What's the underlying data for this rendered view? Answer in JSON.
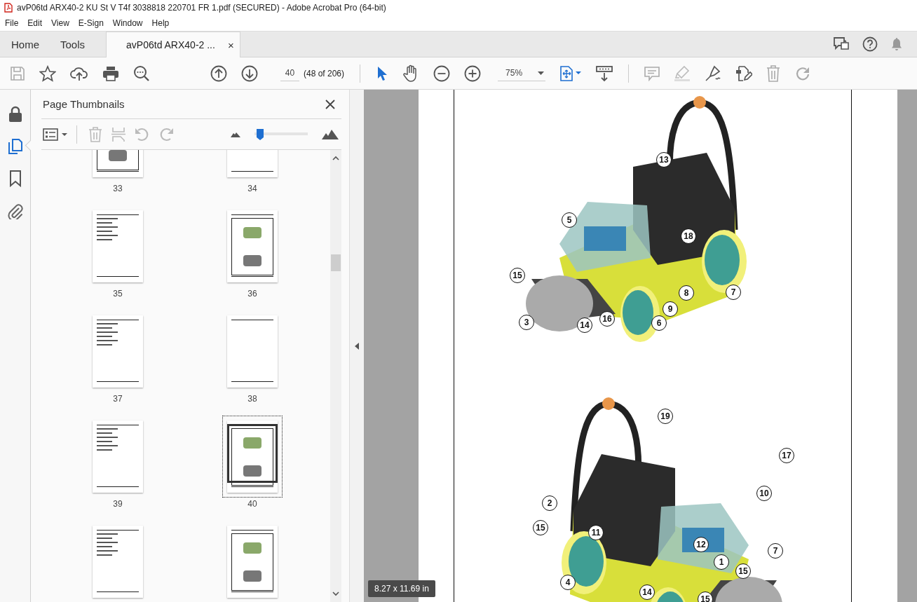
{
  "window": {
    "title": "avP06td ARX40-2 KU St V T4f 3038818 220701 FR 1.pdf (SECURED) - Adobe Acrobat Pro (64-bit)"
  },
  "menu": [
    "File",
    "Edit",
    "View",
    "E-Sign",
    "Window",
    "Help"
  ],
  "tabs": [
    {
      "label": "Home",
      "selected": false,
      "kind": "nav"
    },
    {
      "label": "Tools",
      "selected": false,
      "kind": "nav"
    },
    {
      "label": "avP06td ARX40-2 ...",
      "selected": true,
      "kind": "document",
      "close": "×"
    }
  ],
  "toolbar": {
    "page_number": "40",
    "page_count": "(48 of 206)",
    "zoom": "75%"
  },
  "left_rail": [
    {
      "kind": "lock",
      "selected": false
    },
    {
      "kind": "pages",
      "selected": true
    },
    {
      "kind": "bookmark",
      "selected": false
    },
    {
      "kind": "attachment",
      "selected": false
    }
  ],
  "thumbnails_panel": {
    "title": "Page Thumbnails",
    "size_slider": {
      "level": 0.05
    },
    "pages": [
      {
        "label": "33",
        "kind": "figure",
        "selected": false
      },
      {
        "label": "34",
        "kind": "text",
        "selected": false
      },
      {
        "label": "35",
        "kind": "text",
        "selected": false
      },
      {
        "label": "36",
        "kind": "figure",
        "selected": false
      },
      {
        "label": "37",
        "kind": "text",
        "selected": false
      },
      {
        "label": "38",
        "kind": "blank",
        "selected": false
      },
      {
        "label": "39",
        "kind": "text",
        "selected": false
      },
      {
        "label": "40",
        "kind": "figure",
        "selected": true
      },
      {
        "kind": "text",
        "selected": false
      },
      {
        "kind": "figure",
        "selected": false
      }
    ]
  },
  "document": {
    "figures": [
      {
        "callouts": [
          "13",
          "5",
          "18",
          "15",
          "8",
          "7",
          "9",
          "3",
          "14",
          "16",
          "6"
        ]
      },
      {
        "callouts": [
          "19",
          "17",
          "10",
          "2",
          "15",
          "11",
          "12",
          "7",
          "1",
          "15",
          "4",
          "14",
          "15"
        ]
      }
    ]
  },
  "page_size": "8.27 x 11.69 in"
}
